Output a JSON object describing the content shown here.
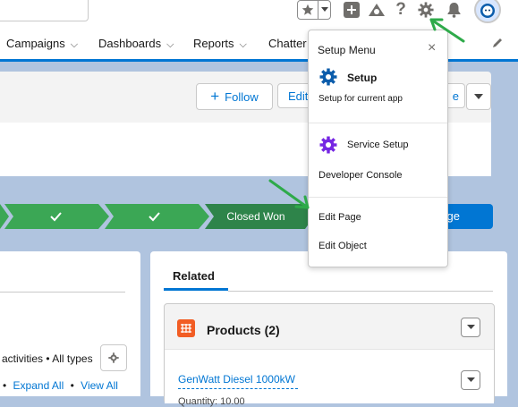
{
  "header": {
    "icons": [
      "star-icon",
      "chevron-down-icon",
      "add-icon",
      "trailhead-icon",
      "help-icon",
      "gear-icon",
      "bell-icon",
      "avatar"
    ]
  },
  "nav": {
    "items": [
      {
        "label": "Campaigns"
      },
      {
        "label": "Dashboards"
      },
      {
        "label": "Reports"
      },
      {
        "label": "Chatter"
      }
    ]
  },
  "highlights": {
    "follow_label": "Follow",
    "edit_label": "Edit",
    "partial_label": "e"
  },
  "path": {
    "closed_won_label": "Closed Won",
    "mark_stage_partial": "ge"
  },
  "activity": {
    "filter_text": "activities • All types",
    "expand_all": "Expand All",
    "separator": "•",
    "view_all": "View All"
  },
  "related": {
    "tab_label": "Related",
    "products_title": "Products (2)",
    "product_name": "GenWatt Diesel 1000kW",
    "product_partial": "Quantity: 10.00"
  },
  "setup_menu": {
    "title": "Setup Menu",
    "close": "×",
    "setup_label": "Setup",
    "setup_sub": "Setup for current app",
    "service_setup_label": "Service Setup",
    "developer_console_label": "Developer Console",
    "edit_page_label": "Edit Page",
    "edit_object_label": "Edit Object"
  },
  "colors": {
    "brand_blue": "#0176d3",
    "path_green": "#3ba755",
    "closed_won_green": "#2e844a",
    "setup_icon_blue": "#0b5cab",
    "service_icon_purple": "#7526e3",
    "products_icon_orange": "#f25d24",
    "annotation_green": "#2eaa4a"
  }
}
